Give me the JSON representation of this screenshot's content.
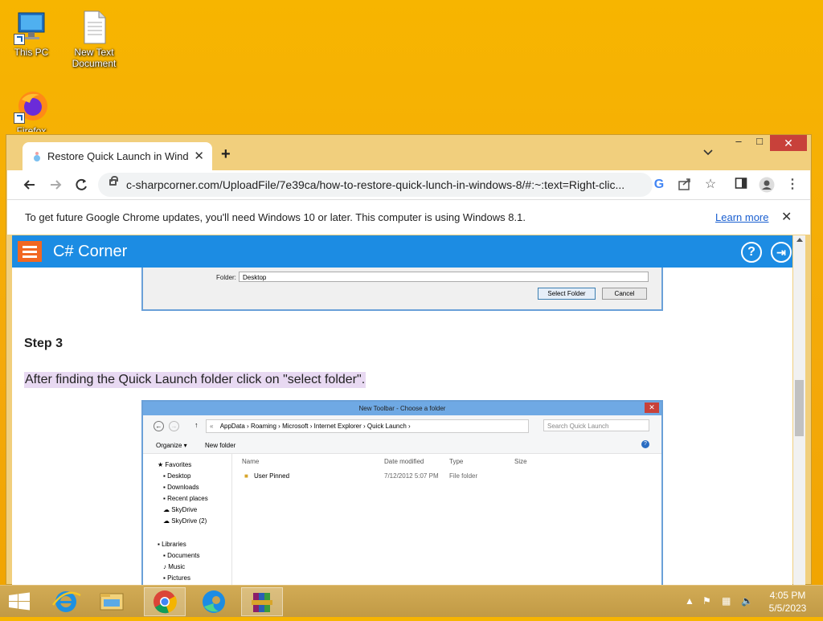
{
  "desktop": {
    "icons": [
      {
        "label": "This PC"
      },
      {
        "label": "New Text Document"
      },
      {
        "label": "Firefox"
      }
    ]
  },
  "browser": {
    "tab": {
      "title": "Restore Quick Launch in Window"
    },
    "new_tab_label": "+",
    "window_controls": {
      "minimize": "–",
      "maximize": "□",
      "close": "✕"
    },
    "address": {
      "url": "c-sharpcorner.com/UploadFile/7e39ca/how-to-restore-quick-lunch-in-windows-8/#:~:text=Right-clic..."
    },
    "infobar": {
      "message": "To get future Google Chrome updates, you'll need Windows 10 or later. This computer is using Windows 8.1.",
      "link": "Learn more",
      "close": "✕"
    }
  },
  "site": {
    "brand": "C# Corner",
    "help_icon": "?",
    "login_icon": "⇥"
  },
  "article": {
    "folder_dialog": {
      "folder_label": "Folder:",
      "folder_value": "Desktop",
      "select_button": "Select Folder",
      "cancel_button": "Cancel"
    },
    "step_title": "Step 3",
    "step_text": "After finding the Quick Launch folder click on \"select folder\".",
    "explorer": {
      "title": "New Toolbar - Choose a folder",
      "breadcrumb": [
        "«",
        "AppData",
        "Roaming",
        "Microsoft",
        "Internet Explorer",
        "Quick Launch"
      ],
      "search_placeholder": "Search Quick Launch",
      "organize": "Organize ▾",
      "new_folder": "New folder",
      "nav": {
        "favorites": "Favorites",
        "favorites_items": [
          "Desktop",
          "Downloads",
          "Recent places",
          "SkyDrive",
          "SkyDrive (2)"
        ],
        "libraries": "Libraries",
        "libraries_items": [
          "Documents",
          "Music",
          "Pictures"
        ]
      },
      "columns": [
        "Name",
        "Date modified",
        "Type",
        "Size"
      ],
      "rows": [
        {
          "name": "User Pinned",
          "date": "7/12/2012 5:07 PM",
          "type": "File folder",
          "size": ""
        }
      ]
    }
  },
  "taskbar": {
    "clock_time": "4:05 PM",
    "clock_date": "5/5/2023"
  }
}
